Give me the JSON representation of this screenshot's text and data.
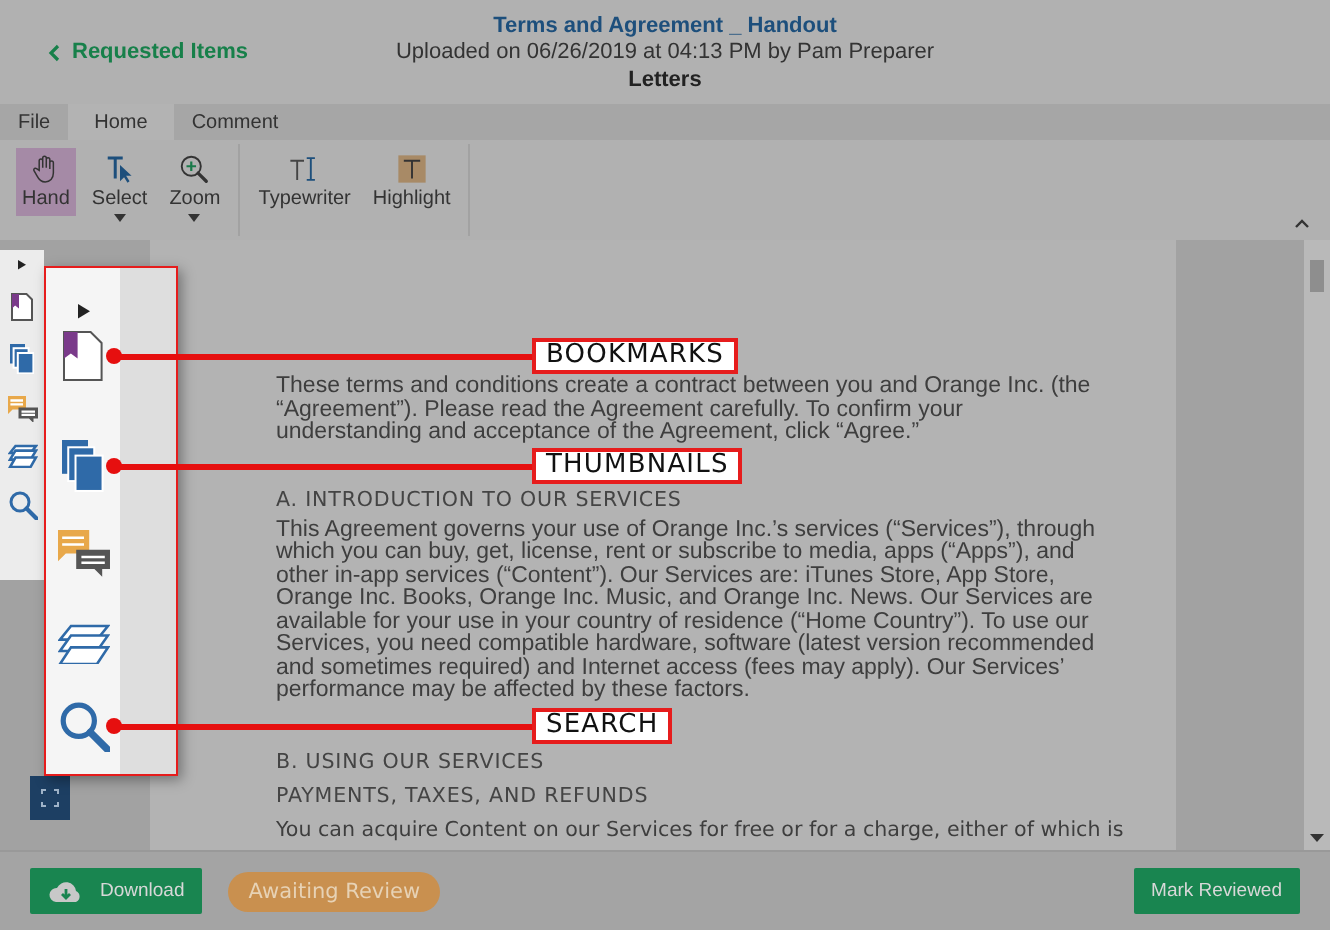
{
  "header": {
    "back_link": "Requested Items",
    "title": "Terms and Agreement _ Handout",
    "subtitle": "Uploaded on 06/26/2019 at 04:13 PM by Pam Preparer",
    "folder": "Letters"
  },
  "tabs": [
    {
      "label": "File",
      "selected": false
    },
    {
      "label": "Home",
      "selected": true
    },
    {
      "label": "Comment",
      "selected": false
    }
  ],
  "toolbar": {
    "groups": [
      {
        "tools": [
          {
            "label": "Hand",
            "selected": true,
            "dropdown": false
          },
          {
            "label": "Select",
            "selected": false,
            "dropdown": true
          },
          {
            "label": "Zoom",
            "selected": false,
            "dropdown": true
          }
        ]
      },
      {
        "tools": [
          {
            "label": "Typewriter",
            "selected": false,
            "dropdown": false
          },
          {
            "label": "Highlight",
            "selected": false,
            "dropdown": false
          }
        ]
      }
    ]
  },
  "mini_sidebar": {
    "items": [
      {
        "kind": "expand"
      },
      {
        "kind": "bookmarks"
      },
      {
        "kind": "thumbnails"
      },
      {
        "kind": "comments"
      },
      {
        "kind": "layers"
      },
      {
        "kind": "search"
      }
    ]
  },
  "panel": {
    "items": [
      {
        "kind": "expand"
      },
      {
        "kind": "bookmarks",
        "callout": "BOOKMARKS"
      },
      {
        "kind": "thumbnails",
        "callout": "THUMBNAILS"
      },
      {
        "kind": "comments"
      },
      {
        "kind": "layers"
      },
      {
        "kind": "search",
        "callout": "SEARCH"
      }
    ]
  },
  "document": {
    "blocks": [
      {
        "kind": "paragraph",
        "text": "These terms and conditions create a contract between you and Orange Inc. (the “Agreement”). Please read the Agreement carefully. To confirm your understanding and acceptance of the Agreement, click “Agree.”"
      },
      {
        "kind": "heading",
        "text": "A. INTRODUCTION TO OUR SERVICES"
      },
      {
        "kind": "paragraph",
        "text": "This Agreement governs your use of Orange Inc.’s services (“Services”), through which you can buy, get, license, rent or subscribe to media, apps (“Apps”), and other in-app services (“Content”). Our Services are: iTunes Store, App Store, Orange Inc. Books, Orange Inc. Music, and Orange Inc. News. Our Services are available for your use in your country of residence (“Home Country”). To use our Services, you need compatible hardware, software (latest version recommended and sometimes required) and Internet access (fees may apply). Our Services’ performance may be affected by these factors."
      },
      {
        "kind": "heading",
        "text": "B. USING OUR SERVICES"
      },
      {
        "kind": "heading",
        "text": "PAYMENTS, TAXES, AND REFUNDS"
      },
      {
        "kind": "plain",
        "text": "You can acquire Content on our Services for free or for a charge, either of which is"
      }
    ]
  },
  "footer": {
    "download": "Download",
    "status": "Awaiting Review",
    "mark_reviewed": "Mark Reviewed"
  }
}
